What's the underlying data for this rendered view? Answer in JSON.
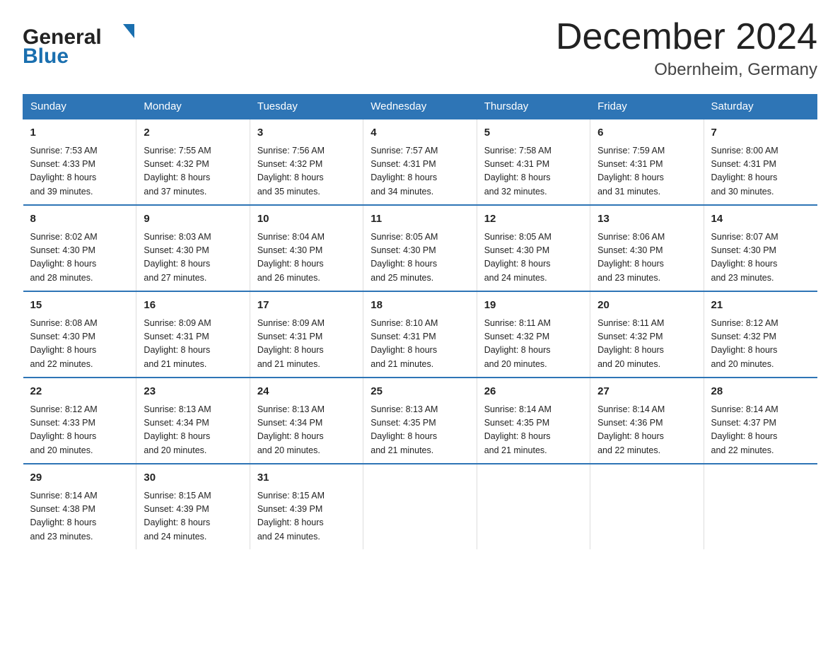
{
  "logo": {
    "general": "General",
    "blue": "Blue",
    "tagline": "Blue"
  },
  "title": "December 2024",
  "subtitle": "Obernheim, Germany",
  "days_of_week": [
    "Sunday",
    "Monday",
    "Tuesday",
    "Wednesday",
    "Thursday",
    "Friday",
    "Saturday"
  ],
  "weeks": [
    [
      {
        "day": "1",
        "sunrise": "7:53 AM",
        "sunset": "4:33 PM",
        "daylight": "8 hours and 39 minutes."
      },
      {
        "day": "2",
        "sunrise": "7:55 AM",
        "sunset": "4:32 PM",
        "daylight": "8 hours and 37 minutes."
      },
      {
        "day": "3",
        "sunrise": "7:56 AM",
        "sunset": "4:32 PM",
        "daylight": "8 hours and 35 minutes."
      },
      {
        "day": "4",
        "sunrise": "7:57 AM",
        "sunset": "4:31 PM",
        "daylight": "8 hours and 34 minutes."
      },
      {
        "day": "5",
        "sunrise": "7:58 AM",
        "sunset": "4:31 PM",
        "daylight": "8 hours and 32 minutes."
      },
      {
        "day": "6",
        "sunrise": "7:59 AM",
        "sunset": "4:31 PM",
        "daylight": "8 hours and 31 minutes."
      },
      {
        "day": "7",
        "sunrise": "8:00 AM",
        "sunset": "4:31 PM",
        "daylight": "8 hours and 30 minutes."
      }
    ],
    [
      {
        "day": "8",
        "sunrise": "8:02 AM",
        "sunset": "4:30 PM",
        "daylight": "8 hours and 28 minutes."
      },
      {
        "day": "9",
        "sunrise": "8:03 AM",
        "sunset": "4:30 PM",
        "daylight": "8 hours and 27 minutes."
      },
      {
        "day": "10",
        "sunrise": "8:04 AM",
        "sunset": "4:30 PM",
        "daylight": "8 hours and 26 minutes."
      },
      {
        "day": "11",
        "sunrise": "8:05 AM",
        "sunset": "4:30 PM",
        "daylight": "8 hours and 25 minutes."
      },
      {
        "day": "12",
        "sunrise": "8:05 AM",
        "sunset": "4:30 PM",
        "daylight": "8 hours and 24 minutes."
      },
      {
        "day": "13",
        "sunrise": "8:06 AM",
        "sunset": "4:30 PM",
        "daylight": "8 hours and 23 minutes."
      },
      {
        "day": "14",
        "sunrise": "8:07 AM",
        "sunset": "4:30 PM",
        "daylight": "8 hours and 23 minutes."
      }
    ],
    [
      {
        "day": "15",
        "sunrise": "8:08 AM",
        "sunset": "4:30 PM",
        "daylight": "8 hours and 22 minutes."
      },
      {
        "day": "16",
        "sunrise": "8:09 AM",
        "sunset": "4:31 PM",
        "daylight": "8 hours and 21 minutes."
      },
      {
        "day": "17",
        "sunrise": "8:09 AM",
        "sunset": "4:31 PM",
        "daylight": "8 hours and 21 minutes."
      },
      {
        "day": "18",
        "sunrise": "8:10 AM",
        "sunset": "4:31 PM",
        "daylight": "8 hours and 21 minutes."
      },
      {
        "day": "19",
        "sunrise": "8:11 AM",
        "sunset": "4:32 PM",
        "daylight": "8 hours and 20 minutes."
      },
      {
        "day": "20",
        "sunrise": "8:11 AM",
        "sunset": "4:32 PM",
        "daylight": "8 hours and 20 minutes."
      },
      {
        "day": "21",
        "sunrise": "8:12 AM",
        "sunset": "4:32 PM",
        "daylight": "8 hours and 20 minutes."
      }
    ],
    [
      {
        "day": "22",
        "sunrise": "8:12 AM",
        "sunset": "4:33 PM",
        "daylight": "8 hours and 20 minutes."
      },
      {
        "day": "23",
        "sunrise": "8:13 AM",
        "sunset": "4:34 PM",
        "daylight": "8 hours and 20 minutes."
      },
      {
        "day": "24",
        "sunrise": "8:13 AM",
        "sunset": "4:34 PM",
        "daylight": "8 hours and 20 minutes."
      },
      {
        "day": "25",
        "sunrise": "8:13 AM",
        "sunset": "4:35 PM",
        "daylight": "8 hours and 21 minutes."
      },
      {
        "day": "26",
        "sunrise": "8:14 AM",
        "sunset": "4:35 PM",
        "daylight": "8 hours and 21 minutes."
      },
      {
        "day": "27",
        "sunrise": "8:14 AM",
        "sunset": "4:36 PM",
        "daylight": "8 hours and 22 minutes."
      },
      {
        "day": "28",
        "sunrise": "8:14 AM",
        "sunset": "4:37 PM",
        "daylight": "8 hours and 22 minutes."
      }
    ],
    [
      {
        "day": "29",
        "sunrise": "8:14 AM",
        "sunset": "4:38 PM",
        "daylight": "8 hours and 23 minutes."
      },
      {
        "day": "30",
        "sunrise": "8:15 AM",
        "sunset": "4:39 PM",
        "daylight": "8 hours and 24 minutes."
      },
      {
        "day": "31",
        "sunrise": "8:15 AM",
        "sunset": "4:39 PM",
        "daylight": "8 hours and 24 minutes."
      },
      null,
      null,
      null,
      null
    ]
  ],
  "labels": {
    "sunrise": "Sunrise:",
    "sunset": "Sunset:",
    "daylight": "Daylight:"
  }
}
